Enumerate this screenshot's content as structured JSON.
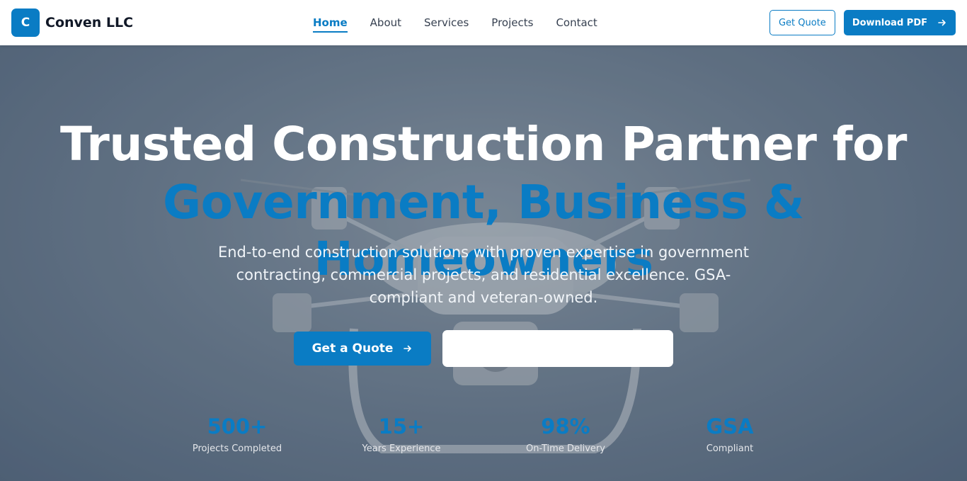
{
  "header": {
    "logo_letter": "C",
    "brand_name": "Conven LLC",
    "nav": [
      {
        "label": "Home",
        "active": true
      },
      {
        "label": "About",
        "active": false
      },
      {
        "label": "Services",
        "active": false
      },
      {
        "label": "Projects",
        "active": false
      },
      {
        "label": "Contact",
        "active": false
      }
    ],
    "get_quote_label": "Get Quote",
    "download_pdf_label": "Download PDF",
    "download_icon": "arrow-right-icon"
  },
  "hero": {
    "headline_line1": "Trusted Construction Partner for",
    "headline_line2": "Government, Business & Homeowners",
    "subtitle": "End-to-end construction solutions with proven expertise in government contracting, commercial projects, and residential excellence. GSA-compliant and veteran-owned.",
    "cta_primary_label": "Get a Quote",
    "cta_icon": "arrow-right-icon",
    "cta_secondary_label": "",
    "background_image": "drone-photo"
  },
  "stats": [
    {
      "value": "500+",
      "label": "Projects Completed"
    },
    {
      "value": "15+",
      "label": "Years Experience"
    },
    {
      "value": "98%",
      "label": "On-Time Delivery"
    },
    {
      "value": "GSA",
      "label": "Compliant"
    }
  ],
  "colors": {
    "accent": "#0a7cc4",
    "header_bg": "#ffffff",
    "heading_white": "#ffffff"
  }
}
